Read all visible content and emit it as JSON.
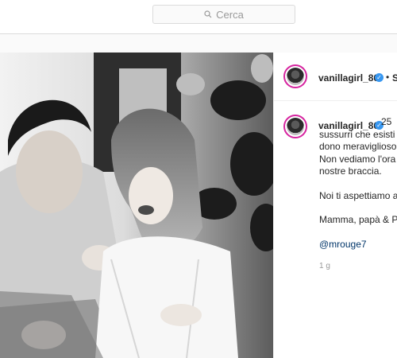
{
  "search": {
    "placeholder": "Cerca",
    "icon": "search-icon"
  },
  "header": {
    "username": "vanillagirl_86",
    "separator": "•",
    "follow_label": "S"
  },
  "caption": {
    "username": "vanillagirl_86",
    "line1": "25",
    "line2": "sussurri che esisti e",
    "line3": "dono meraviglioso.",
    "line4": "Non vediamo l'ora d",
    "line5": "nostre braccia.",
    "line6": "Noi ti aspettiamo a",
    "line7": "Mamma, papà & Pa",
    "mention": "@mrouge7"
  },
  "timestamp": "1 g",
  "colors": {
    "accent": "#3897f0",
    "story_ring": "#d6249f",
    "mention": "#003569"
  }
}
